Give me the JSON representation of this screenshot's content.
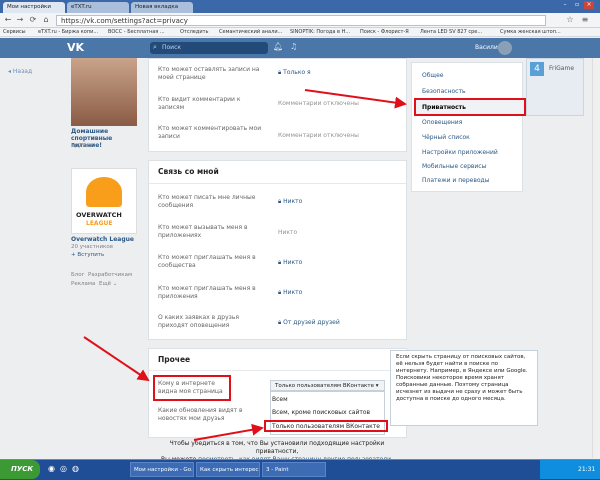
{
  "browser": {
    "tabs": [
      {
        "label": "Мои настройки"
      },
      {
        "label": "eTXT.ru"
      },
      {
        "label": "Новая вкладка"
      }
    ],
    "url": "https://vk.com/settings?act=privacy",
    "bookmarks": [
      "Сервисы",
      "eTXT.ru - Биржа копи...",
      "BOCC - Бесплатная ...",
      "Отследить",
      "Семантический анали...",
      "SINOPTIK: Погода в Н...",
      "Поиск - Флорист-Я",
      "Лента LED SV 827 сре...",
      "Сумка женская штоп..."
    ]
  },
  "vk": {
    "search_placeholder": "Поиск",
    "username": "Василий",
    "back_link": "◂ Назад",
    "groups": [
      {
        "title": "Домашние спортивные питание!",
        "sub": "Группа"
      },
      {
        "title": "Overwatch League",
        "sub": "20 участников",
        "action": "+ Вступить"
      }
    ],
    "footer_links": [
      "Блог",
      "Разработчикам",
      "Реклама",
      "Ещё ⌄"
    ],
    "privacy_rows_top": [
      {
        "label": "Кто может оставлять записи на моей странице",
        "value": "Только я",
        "gray": false
      },
      {
        "label": "Кто видит комментарии к записям",
        "value": "Комментарии отключены",
        "gray": true
      },
      {
        "label": "Кто может комментировать мои записи",
        "value": "Комментарии отключены",
        "gray": true
      }
    ],
    "contact_section": {
      "title": "Связь со мной",
      "rows": [
        {
          "label": "Кто может писать мне личные сообщения",
          "value": "Никто",
          "gray": false
        },
        {
          "label": "Кто может вызывать меня в приложениях",
          "value": "Никто",
          "gray": true
        },
        {
          "label": "Кто может приглашать меня в сообщества",
          "value": "Никто",
          "gray": false
        },
        {
          "label": "Кто может приглашать меня в приложения",
          "value": "Никто",
          "gray": false
        },
        {
          "label": "О каких заявках в друзья приходят оповещения",
          "value": "От друзей друзей",
          "gray": false
        }
      ]
    },
    "other_section": {
      "title": "Прочее",
      "row1_label": "Кому в интернете видна моя страница",
      "row2_label": "Какие обновления видят в новостях мои друзья",
      "dropdown_value": "Только пользователям ВКонтакте ▾",
      "dropdown_options": [
        "Всем",
        "Всем, кроме поисковых сайтов",
        "Только пользователям ВКонтакте"
      ]
    },
    "tooltip_text": "Если скрыть страницу от поисковых сайтов, её нельзя будет найти в поиске по интернету. Например, в Яндексе или Google. Поисковики некоторое время хранят собранные данные. Поэтому страница исчезнет из выдачи не сразу и может быть доступна в поиске до одного месяца.",
    "note_line1": "Чтобы убедиться в том, что Вы установили подходящие настройки приватности,",
    "note_line2_pre": "Вы можете ",
    "note_link": "посмотреть, как видят Вашу страницу другие пользователи",
    "note_line2_post": ".",
    "menu": [
      {
        "label": "Общее",
        "active": false
      },
      {
        "label": "Безопасность",
        "active": false
      },
      {
        "label": "Приватность",
        "active": true
      },
      {
        "label": "Оповещения",
        "active": false
      },
      {
        "label": "Чёрный список",
        "active": false
      },
      {
        "label": "Настройки приложений",
        "active": false
      },
      {
        "label": "Мобильные сервисы",
        "active": false
      },
      {
        "label": "Платежи и переводы",
        "active": false
      }
    ],
    "ad_title": "FriGame"
  },
  "taskbar": {
    "start_label": "ПУСК",
    "tasks": [
      "Мои настройки - Go...",
      "Как скрыть интерес...",
      "3 - Paint"
    ],
    "clock": "21:31"
  },
  "colors": {
    "vk_blue": "#4a76a8",
    "highlight_red": "#e0101a",
    "taskbar": "#1f4e97"
  }
}
